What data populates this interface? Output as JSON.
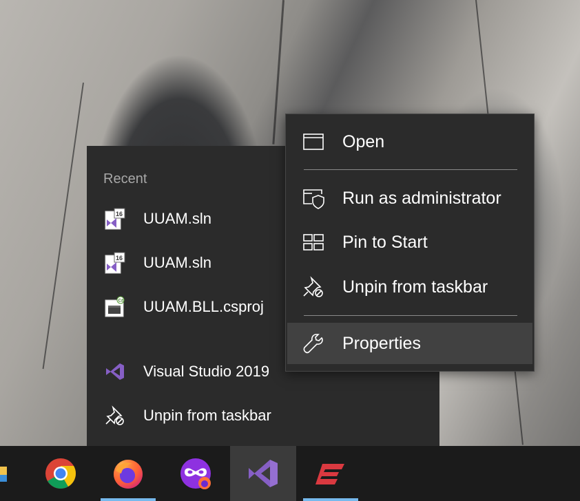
{
  "jumplist": {
    "header": "Recent",
    "recent_items": [
      {
        "label": "UUAM.sln",
        "icon": "vs-solution-icon"
      },
      {
        "label": "UUAM.sln",
        "icon": "vs-solution-icon"
      },
      {
        "label": "UUAM.BLL.csproj",
        "icon": "csharp-project-icon"
      }
    ],
    "tasks": [
      {
        "label": "Visual Studio 2019",
        "icon": "visual-studio-icon"
      },
      {
        "label": "Unpin from taskbar",
        "icon": "unpin-icon"
      }
    ],
    "badge_text": "16",
    "badge_cs": "C#"
  },
  "context_menu": {
    "items": [
      {
        "label": "Open",
        "icon": "window-icon"
      },
      {
        "label": "Run as administrator",
        "icon": "shield-window-icon"
      },
      {
        "label": "Pin to Start",
        "icon": "pin-to-start-icon"
      },
      {
        "label": "Unpin from taskbar",
        "icon": "unpin-icon"
      },
      {
        "label": "Properties",
        "icon": "wrench-icon",
        "highlighted": true
      }
    ]
  },
  "taskbar": {
    "apps": [
      {
        "name": "file-explorer",
        "running": false
      },
      {
        "name": "chrome",
        "running": false
      },
      {
        "name": "firefox",
        "running": true
      },
      {
        "name": "firefox-private",
        "running": false
      },
      {
        "name": "visual-studio",
        "running": false,
        "active": true
      },
      {
        "name": "expressvpn",
        "running": true
      }
    ]
  },
  "colors": {
    "menu_bg": "#2b2b2b",
    "highlight_bg": "#414141",
    "taskbar_bg": "#1b1b1b",
    "running_indicator": "#76b9ed",
    "vs_purple": "#865fc5"
  }
}
